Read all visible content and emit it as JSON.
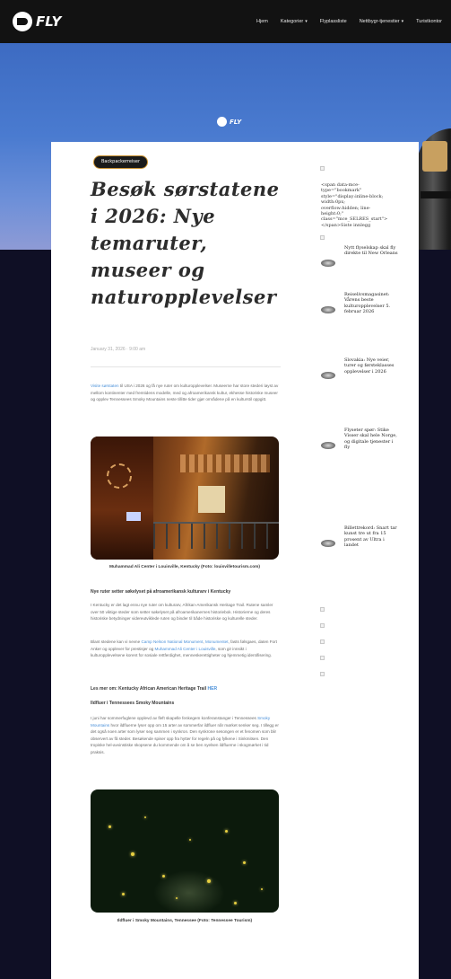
{
  "nav": {
    "logo_text": "FLY",
    "links": [
      {
        "label": "Hjem",
        "has_caret": false
      },
      {
        "label": "Kategorier",
        "has_caret": true
      },
      {
        "label": "Flyplassliste",
        "has_caret": false
      },
      {
        "label": "Nettbygr-tjenestier",
        "has_caret": true
      },
      {
        "label": "Turistkontor",
        "has_caret": false
      }
    ]
  },
  "hero": {
    "logo_text": "FLY"
  },
  "article": {
    "category": "Backpackerreiser",
    "title": "Besøk sørstatene i 2026: Nye temaruter, museer og naturopplevelser",
    "date": "January 31, 2026 · 9:00 am",
    "intro_link": "Visite sørstaten",
    "intro": " til USA i 2026 og få nye ruter om kulturopplevelser. Museerne har store stederi løyst av mellom kontinenter med fremtidens modelle, med og afroamerikansk kultur, ekhesse historiske museer og opplev Tennessees Smoky Mountains neste tillitte tider gjør områdene på en kulturstil oppgitt.",
    "figure1_caption": "Muhammad Ali Center i Louisville, Kentucky (Foto: louisvilletourism.com)",
    "section1_heading": "Nye ruter setter søkelyset på afroamerikansk kulturarv i Kentucky",
    "section1_p1": "I Kentucky er det lagt ennu nye ruter om kulturarv, Afrikan-Amerikansk Heritage Trail. Rutene samler over 50 viktige steder som setter søkelyset på afroamerikanernes historiebok. Historierne og deres historiske betydninger videreutviklede ruten og binder til både historiske og kulturelle steder.",
    "section1_p2_start": "Blant stedene kan vi nevne ",
    "section1_p2_link1": "Camp Nelson National Monument",
    "section1_p2_mid1": ", ",
    "section1_p2_link2": "Monumentet",
    "section1_p2_mid2": ", fasts følsgaes, daten Fort Anker og opplever for prestisjer og ",
    "section1_p2_link3": "Muhammad Ali Center i Louisville",
    "section1_p2_end": ", som gir innsikt i kulturopplevelsene korent for sosiale rettferdighet, menneskerettigheter og hjemmetig identifisering.",
    "read_more_prefix": "Les mer om: Kentucky African American Heritage Trail",
    "read_more_link": "HER",
    "section2_heading": "Ildfluer i Tennessees Smoky Mountains",
    "section2_p1_start": "I juni har sommerfuglene opplevd av fleft skapelle fenkegem konferanstanger i Tennessees ",
    "section2_p1_link": "Smoky Mountains",
    "section2_p1_end": " hvor ildfluerne lyser opp om 15 arter av sommerfar ildfluer når mørket senker seg. I tillegg er det også noen arter som lyser seg sammen i synkron. Den synkrone sesongen er et fenomen som blir observert av få steder. Besøkende spiser opp fra hytter for regeln på og fylkene i Sinkmitsen. Den tropiske hel-avvinstiske skopsene du kommende om å se ben nyelsen ildfluerne i skogmørket i tid praksis.",
    "figure2_caption": "Ildfluer i Smoky Mountains, Tennessee (Foto: Tennessee Tourism)"
  },
  "sidebar": {
    "raw_html_text": "<span data-mce-type=\"bookmark\" style=\"display:inline-block; width:0px; overflow:hidden; line-height:0;\" class=\"mce_SELRES_start\"></span>Siste innlegg",
    "recent_posts": [
      {
        "title": "Nytt flyselskap skal fly direkte til New Orleans"
      },
      {
        "title": "Reiselivsmagasinet: Vårens beste kulturopplevelser 5. februar 2026"
      },
      {
        "title": "Slovakia: Nye veier, turer og førsteklasses opplevelser i 2026"
      },
      {
        "title": "Flyseter spør: Stike Visser skal hele Norge, og digitale tjenester i fly"
      },
      {
        "title": "Billettrekord: Snart tar kunst tre ut fra 15 prosent av Ultra i landet"
      }
    ]
  }
}
